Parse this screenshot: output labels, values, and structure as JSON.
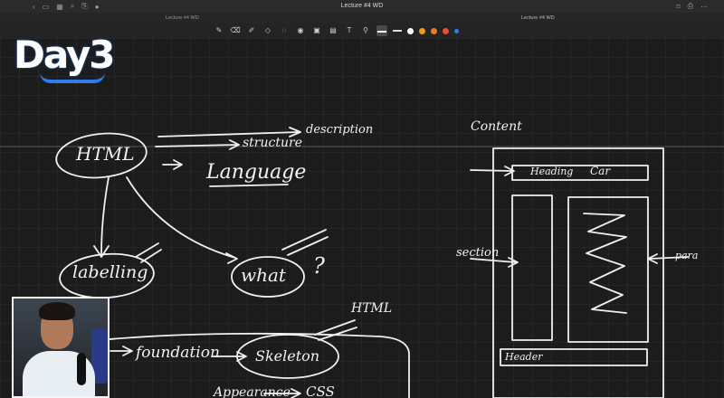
{
  "window": {
    "title": "Lecture #4 WD",
    "tabs": [
      "Lecture #4 WD",
      "Lecture #4 WD"
    ]
  },
  "toolbar": {
    "tools": [
      "pen-icon",
      "eraser-icon",
      "highlighter-icon",
      "shapes-icon",
      "lasso-icon",
      "image-icon",
      "camera-icon",
      "text-icon",
      "link-icon"
    ],
    "colors": [
      "#ffffff",
      "#f39c12",
      "#e67e22",
      "#e74c3c",
      "#2f7df0"
    ]
  },
  "badge": {
    "text": "Day3"
  },
  "notes": {
    "html": "HTML",
    "arrow_dash": "- - >",
    "description": "description",
    "structure": "structure",
    "language": "Language",
    "labelling": "labelling",
    "what": "what",
    "question": "?",
    "html_small": "HTML",
    "foundation": "foundation",
    "skeleton": "Skeleton",
    "appearance": "Appearance",
    "css": "CSS",
    "content": "Content",
    "heading": "Heading",
    "car": "Car",
    "section": "section",
    "para": "para",
    "header_bottom": "Header"
  }
}
